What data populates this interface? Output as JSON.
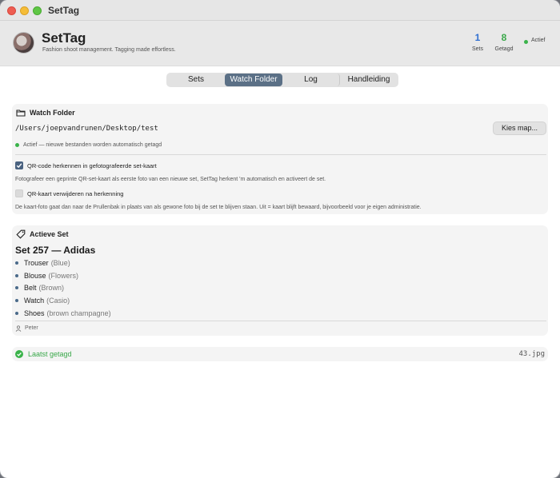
{
  "window": {
    "title": "SetTag"
  },
  "header": {
    "app_name": "SetTag",
    "tagline": "Fashion shoot management. Tagging made effortless.",
    "stats": {
      "sets_value": "1",
      "sets_label": "Sets",
      "tagged_value": "8",
      "tagged_label": "Getagd"
    },
    "status_label": "Actief",
    "colors": {
      "sets": "#2f6fd1",
      "tagged": "#3aa84a",
      "status": "#3ab34a"
    }
  },
  "tabs": [
    {
      "label": "Sets",
      "selected": false
    },
    {
      "label": "Watch Folder",
      "selected": true
    },
    {
      "label": "Log",
      "selected": false
    },
    {
      "label": "Handleiding",
      "selected": false
    }
  ],
  "watch_folder": {
    "title": "Watch Folder",
    "icon": "folder-icon",
    "path": "/Users/joepvandrunen/Desktop/test",
    "choose_button": "Kies map...",
    "status": "Actief — nieuwe bestanden worden automatisch getagd",
    "qr_option": {
      "label": "QR-code herkennen in gefotografeerde set-kaart",
      "checked": true,
      "description": "Fotografeer een geprinte QR-set-kaart als eerste foto van een nieuwe set, SetTag herkent 'm automatisch en activeert de set."
    },
    "remove_option": {
      "label": "QR-kaart verwijderen na herkenning",
      "checked": false,
      "description": "De kaart-foto gaat dan naar de Prullenbak in plaats van als gewone foto bij de set te blijven staan. Uit = kaart blijft bewaard, bijvoorbeeld voor je eigen administratie."
    }
  },
  "active_set": {
    "title": "Actieve Set",
    "icon": "tag-icon",
    "set_name": "Set 257 — Adidas",
    "items": [
      {
        "name": "Trouser",
        "note": "(Blue)"
      },
      {
        "name": "Blouse",
        "note": "(Flowers)"
      },
      {
        "name": "Belt",
        "note": "(Brown)"
      },
      {
        "name": "Watch",
        "note": "(Casio)"
      },
      {
        "name": "Shoes",
        "note": "(brown champagne)"
      }
    ],
    "photographer": "Peter"
  },
  "last_tagged": {
    "label": "Laatst getagd",
    "file": "43.jpg"
  }
}
